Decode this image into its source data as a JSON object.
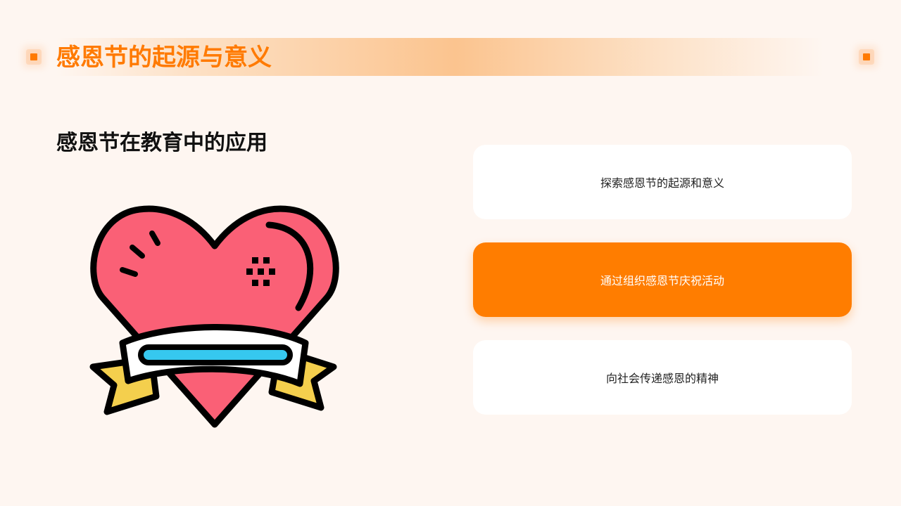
{
  "header": {
    "title": "感恩节的起源与意义"
  },
  "section": {
    "title": "感恩节在教育中的应用"
  },
  "cards": [
    {
      "label": "探索感恩节的起源和意义"
    },
    {
      "label": "通过组织感恩节庆祝活动"
    },
    {
      "label": "向社会传递感恩的精神"
    }
  ],
  "colors": {
    "accent": "#ff7d00",
    "background": "#fef6f1",
    "heart": "#fa6076",
    "ribbon_stripe": "#36c8ef",
    "ribbon_tail": "#f4cf4d"
  },
  "illustration": {
    "icon": "heart-with-ribbon-icon"
  }
}
